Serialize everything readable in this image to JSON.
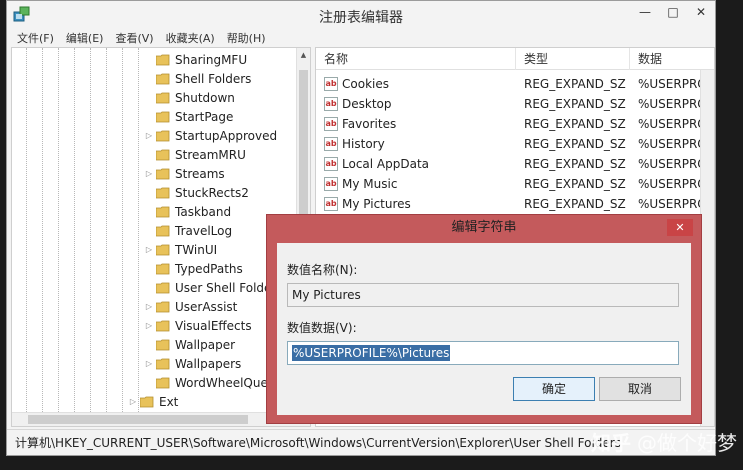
{
  "window": {
    "title": "注册表编辑器",
    "controls": {
      "minimize": "—",
      "maximize": "□",
      "close": "✕"
    }
  },
  "menu": [
    "文件(F)",
    "编辑(E)",
    "查看(V)",
    "收藏夹(A)",
    "帮助(H)"
  ],
  "tree": {
    "items": [
      {
        "label": "SharingMFU",
        "expander": ""
      },
      {
        "label": "Shell Folders",
        "expander": ""
      },
      {
        "label": "Shutdown",
        "expander": ""
      },
      {
        "label": "StartPage",
        "expander": ""
      },
      {
        "label": "StartupApproved",
        "expander": "▷"
      },
      {
        "label": "StreamMRU",
        "expander": ""
      },
      {
        "label": "Streams",
        "expander": "▷"
      },
      {
        "label": "StuckRects2",
        "expander": ""
      },
      {
        "label": "Taskband",
        "expander": ""
      },
      {
        "label": "TravelLog",
        "expander": ""
      },
      {
        "label": "TWinUI",
        "expander": "▷"
      },
      {
        "label": "TypedPaths",
        "expander": ""
      },
      {
        "label": "User Shell Folde",
        "expander": ""
      },
      {
        "label": "UserAssist",
        "expander": "▷"
      },
      {
        "label": "VisualEffects",
        "expander": "▷"
      },
      {
        "label": "Wallpaper",
        "expander": ""
      },
      {
        "label": "Wallpapers",
        "expander": "▷"
      },
      {
        "label": "WordWheelQue",
        "expander": ""
      }
    ],
    "parent_item": {
      "label": "Ext",
      "expander": "▷"
    }
  },
  "list": {
    "headers": {
      "name": "名称",
      "type": "类型",
      "data": "数据"
    },
    "rows": [
      {
        "name": "Cookies",
        "type": "REG_EXPAND_SZ",
        "data": "%USERPRO"
      },
      {
        "name": "Desktop",
        "type": "REG_EXPAND_SZ",
        "data": "%USERPRO"
      },
      {
        "name": "Favorites",
        "type": "REG_EXPAND_SZ",
        "data": "%USERPRO"
      },
      {
        "name": "History",
        "type": "REG_EXPAND_SZ",
        "data": "%USERPRO"
      },
      {
        "name": "Local AppData",
        "type": "REG_EXPAND_SZ",
        "data": "%USERPRO"
      },
      {
        "name": "My Music",
        "type": "REG_EXPAND_SZ",
        "data": "%USERPRO"
      },
      {
        "name": "My Pictures",
        "type": "REG_EXPAND_SZ",
        "data": "%USERPRO"
      }
    ],
    "icon_text": "ab"
  },
  "status": {
    "path": "计算机\\HKEY_CURRENT_USER\\Software\\Microsoft\\Windows\\CurrentVersion\\Explorer\\User Shell Folders"
  },
  "dialog": {
    "title": "编辑字符串",
    "close": "✕",
    "name_label": "数值名称(N):",
    "name_value": "My Pictures",
    "data_label": "数值数据(V):",
    "data_value": "%USERPROFILE%\\Pictures",
    "ok": "确定",
    "cancel": "取消"
  },
  "watermark": {
    "logo": "知乎",
    "text": "@做个好梦"
  },
  "colors": {
    "dialog_frame": "#c45a5c",
    "selection": "#3a6ea5",
    "folder": "#e8c25a"
  }
}
